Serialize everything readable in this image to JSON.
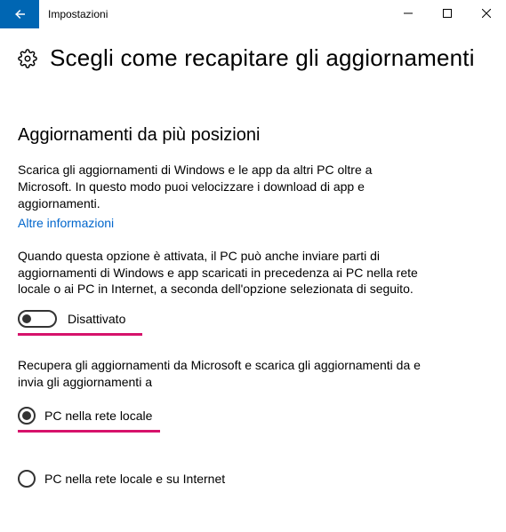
{
  "window": {
    "title": "Impostazioni"
  },
  "header": {
    "title": "Scegli come recapitare gli aggiornamenti"
  },
  "section": {
    "title": "Aggiornamenti da più posizioni",
    "intro": "Scarica gli aggiornamenti di Windows e le app da altri PC oltre a Microsoft. In questo modo puoi velocizzare i download di app e aggiornamenti.",
    "link": "Altre informazioni",
    "description": "Quando questa opzione è attivata, il PC può anche inviare parti di aggiornamenti di Windows e app scaricati in precedenza ai PC nella rete locale o ai PC in Internet, a seconda dell'opzione selezionata di seguito.",
    "toggle_label": "Disattivato",
    "source_text": "Recupera gli aggiornamenti da Microsoft e scarica gli aggiornamenti da e invia gli aggiornamenti a",
    "option1": "PC nella rete locale",
    "option2": "PC nella rete locale e su Internet"
  }
}
